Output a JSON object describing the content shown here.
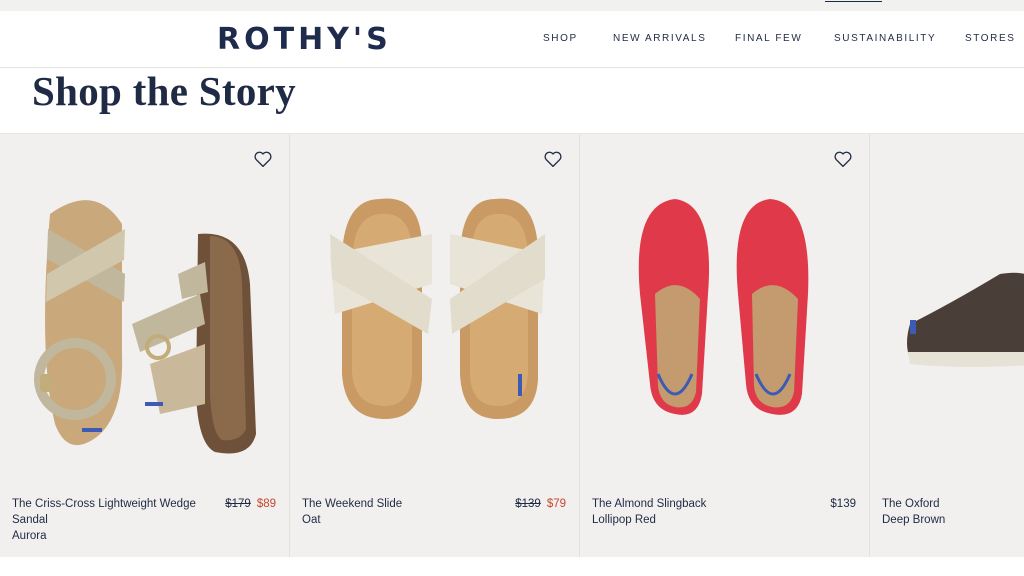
{
  "brand": {
    "logo": "ROTHY'S"
  },
  "nav": {
    "items": [
      "SHOP",
      "NEW ARRIVALS",
      "FINAL FEW",
      "SUSTAINABILITY",
      "STORES"
    ]
  },
  "page": {
    "title": "Shop the Story"
  },
  "products": [
    {
      "name": "The Criss-Cross Lightweight Wedge Sandal",
      "color": "Aurora",
      "was_price": "$179",
      "price": "$89",
      "on_sale": true
    },
    {
      "name": "The Weekend Slide",
      "color": "Oat",
      "was_price": "$139",
      "price": "$79",
      "on_sale": true
    },
    {
      "name": "The Almond Slingback",
      "color": "Lollipop Red",
      "price": "$139",
      "on_sale": false
    },
    {
      "name": "The Oxford",
      "color": "Deep Brown",
      "on_sale": false
    }
  ],
  "colors": {
    "navy": "#1f2a44",
    "sale_red": "#c5482f",
    "card_bg": "#f1f0ee"
  },
  "icons": {
    "wishlist": "heart-icon"
  }
}
